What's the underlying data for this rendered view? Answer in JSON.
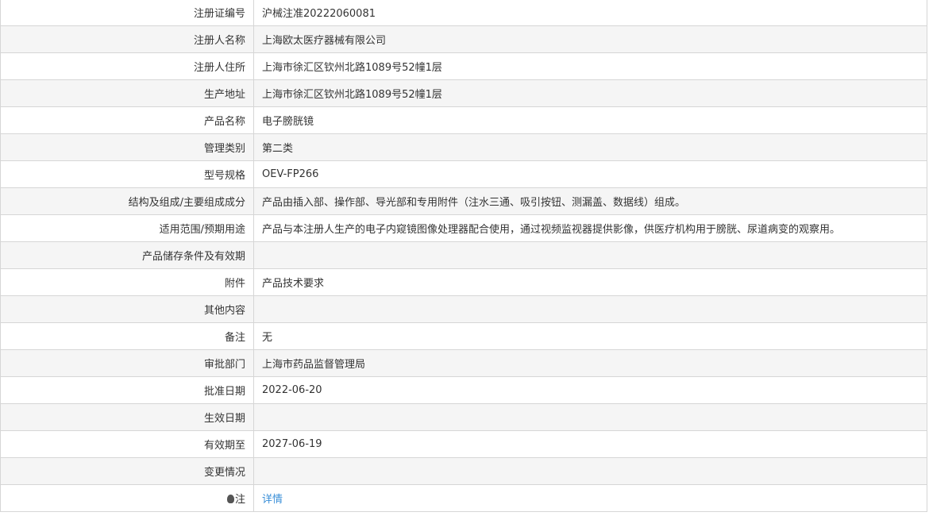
{
  "rows": [
    {
      "label": "注册证编号",
      "value": "沪械注准20222060081"
    },
    {
      "label": "注册人名称",
      "value": "上海欧太医疗器械有限公司"
    },
    {
      "label": "注册人住所",
      "value": "上海市徐汇区钦州北路1089号52幢1层"
    },
    {
      "label": "生产地址",
      "value": "上海市徐汇区钦州北路1089号52幢1层"
    },
    {
      "label": "产品名称",
      "value": "电子膀胱镜"
    },
    {
      "label": "管理类别",
      "value": "第二类"
    },
    {
      "label": "型号规格",
      "value": "OEV-FP266"
    },
    {
      "label": "结构及组成/主要组成成分",
      "value": "产品由插入部、操作部、导光部和专用附件（注水三通、吸引按钮、测漏盖、数据线）组成。"
    },
    {
      "label": "适用范围/预期用途",
      "value": "产品与本注册人生产的电子内窥镜图像处理器配合使用，通过视频监视器提供影像，供医疗机构用于膀胱、尿道病变的观察用。"
    },
    {
      "label": "产品储存条件及有效期",
      "value": ""
    },
    {
      "label": "附件",
      "value": "产品技术要求"
    },
    {
      "label": "其他内容",
      "value": ""
    },
    {
      "label": "备注",
      "value": "无"
    },
    {
      "label": "审批部门",
      "value": "上海市药品监督管理局"
    },
    {
      "label": "批准日期",
      "value": "2022-06-20"
    },
    {
      "label": "生效日期",
      "value": ""
    },
    {
      "label": "有效期至",
      "value": "2027-06-19"
    },
    {
      "label": "变更情况",
      "value": ""
    }
  ],
  "note": {
    "label": "注",
    "link": "详情"
  }
}
